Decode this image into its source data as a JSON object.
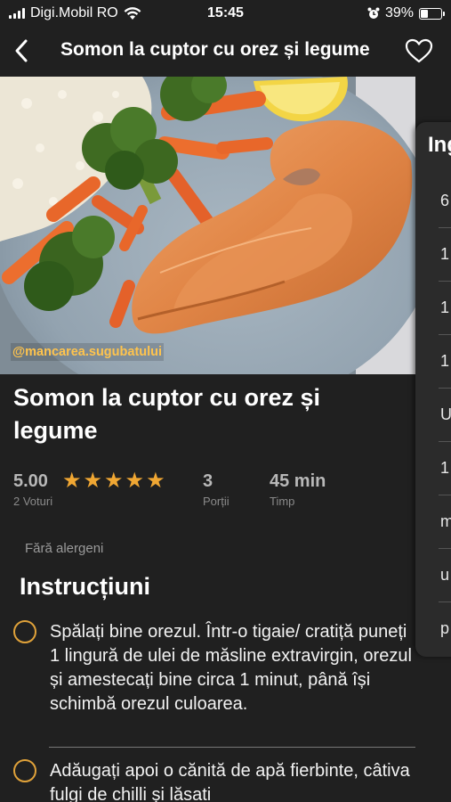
{
  "status_bar": {
    "carrier": "Digi.Mobil RO",
    "time": "15:45",
    "battery_percent": "39%",
    "battery_level": 0.39,
    "icons": [
      "signal-icon",
      "wifi-icon",
      "alarm-icon",
      "battery-icon"
    ]
  },
  "nav": {
    "title": "Somon la cuptor cu orez și legume",
    "back_icon": "chevron-left-icon",
    "favorite_icon": "heart-outline-icon"
  },
  "hero": {
    "watermark": "@mancarea.sugubatului"
  },
  "recipe": {
    "title": "Somon la cuptor cu orez și legume",
    "rating": "5.00",
    "stars": 5,
    "votes": "2 Voturi",
    "servings": "3",
    "servings_label": "Porții",
    "time": "45 min",
    "time_label": "Timp",
    "allergens": "Fără alergeni"
  },
  "instructions": {
    "title": "Instrucțiuni",
    "steps": [
      "Spălați bine orezul. Într-o tigaie/ cratiță puneți 1 lingură de ulei de măsline extravirgin, orezul și amestecați bine circa 1 minut, până își schimbă orezul culoarea.",
      "Adăugați apoi o cănită de apă fierbinte, câtiva fulgi de chilli și lăsati"
    ]
  },
  "ingredients_panel": {
    "title": "Ing",
    "rows": [
      "6",
      "1",
      "1",
      "1",
      "U",
      "1",
      "m",
      "u",
      "p"
    ]
  },
  "colors": {
    "background": "#202020",
    "accent": "#f0a733",
    "watermark": "#ffc44d"
  }
}
